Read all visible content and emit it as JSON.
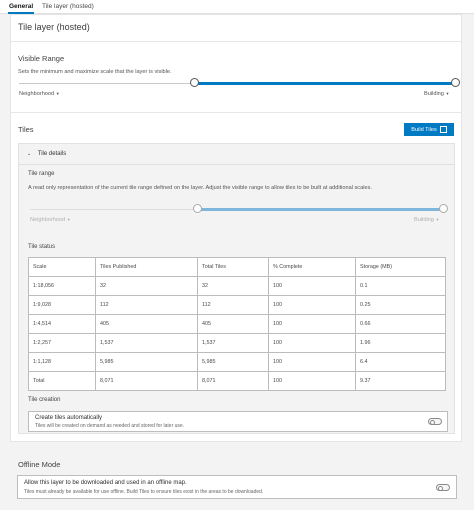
{
  "tabs": [
    {
      "label": "General"
    },
    {
      "label": "Tile layer (hosted)"
    }
  ],
  "page_title": "Tile layer (hosted)",
  "visible_range": {
    "title": "Visible Range",
    "description": "Sets the minimum and maximize scale that the layer is visible.",
    "min_label": "Neighborhood",
    "max_label": "Building",
    "min_position_fraction": 0.43,
    "max_position_fraction": 1.0
  },
  "tiles": {
    "title": "Tiles",
    "build_button": "Build Tiles",
    "details": {
      "title": "Tile details",
      "tile_range_title": "Tile range",
      "tile_range_description": "A read only representation of the current tile range defined on the layer. Adjust the visible range to allow tiles to be built at additional scales.",
      "range_min_label": "Neighborhood",
      "range_max_label": "Building",
      "tile_status_title": "Tile status",
      "columns": [
        "Scale",
        "Tiles Published",
        "Total Tiles",
        "% Complete",
        "Storage (MB)"
      ],
      "rows": [
        [
          "1:18,056",
          "32",
          "32",
          "100",
          "0.1"
        ],
        [
          "1:9,028",
          "112",
          "112",
          "100",
          "0.25"
        ],
        [
          "1:4,514",
          "405",
          "405",
          "100",
          "0.66"
        ],
        [
          "1:2,257",
          "1,537",
          "1,537",
          "100",
          "1.96"
        ],
        [
          "1:1,128",
          "5,985",
          "5,985",
          "100",
          "6.4"
        ],
        [
          "Total",
          "8,071",
          "8,071",
          "100",
          "9.37"
        ]
      ],
      "tile_creation_title": "Tile creation",
      "create_auto_label": "Create tiles automatically",
      "create_auto_description": "Tiles will be created on demand as needed and stored for later use.",
      "create_auto_enabled": false
    }
  },
  "offline": {
    "title": "Offline Mode",
    "allow_label": "Allow this layer to be downloaded and used in an offline map.",
    "allow_description": "Tiles must already be available for use offline. Build Tiles to ensure tiles exist in the areas to be downloaded.",
    "allow_enabled": false
  },
  "colors": {
    "accent": "#007ac2",
    "background": "#f3f3f3"
  }
}
